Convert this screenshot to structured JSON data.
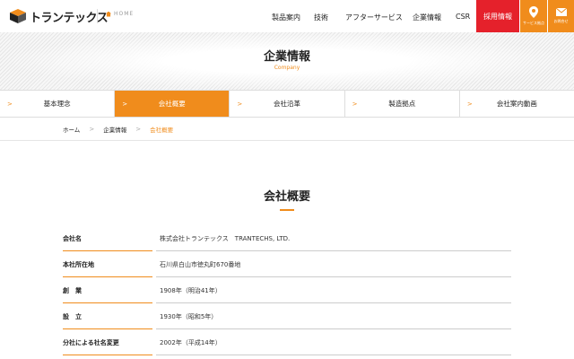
{
  "header": {
    "logo_text": "トランテックス",
    "home_label": "HOME",
    "nav": [
      "製品案内",
      "技術",
      "アフターサービス",
      "企業情報",
      "CSR"
    ],
    "recruit_label": "採用情報",
    "service_label": "サービス拠点",
    "contact_label": "お問合せ"
  },
  "hero": {
    "title": "企業情報",
    "subtitle": "Company"
  },
  "subnav": {
    "items": [
      "基本理念",
      "会社概要",
      "会社沿革",
      "製造拠点",
      "会社案内動画"
    ],
    "active_index": 1
  },
  "breadcrumb": {
    "items": [
      "ホーム",
      "企業情報",
      "会社概要"
    ]
  },
  "section": {
    "title": "会社概要"
  },
  "company_info": [
    {
      "key": "会社名",
      "value": "株式会社トランテックス　TRANTECHS, LTD."
    },
    {
      "key": "本社所在地",
      "value": "石川県白山市徳丸町670番地"
    },
    {
      "key": "創　業",
      "value": "1908年（明治41年）"
    },
    {
      "key": "設　立",
      "value": "1930年（昭和5年）"
    },
    {
      "key": "分社による社名変更",
      "value": "2002年（平成14年）"
    }
  ],
  "colors": {
    "accent": "#f08c1c",
    "recruit": "#e5212b"
  }
}
